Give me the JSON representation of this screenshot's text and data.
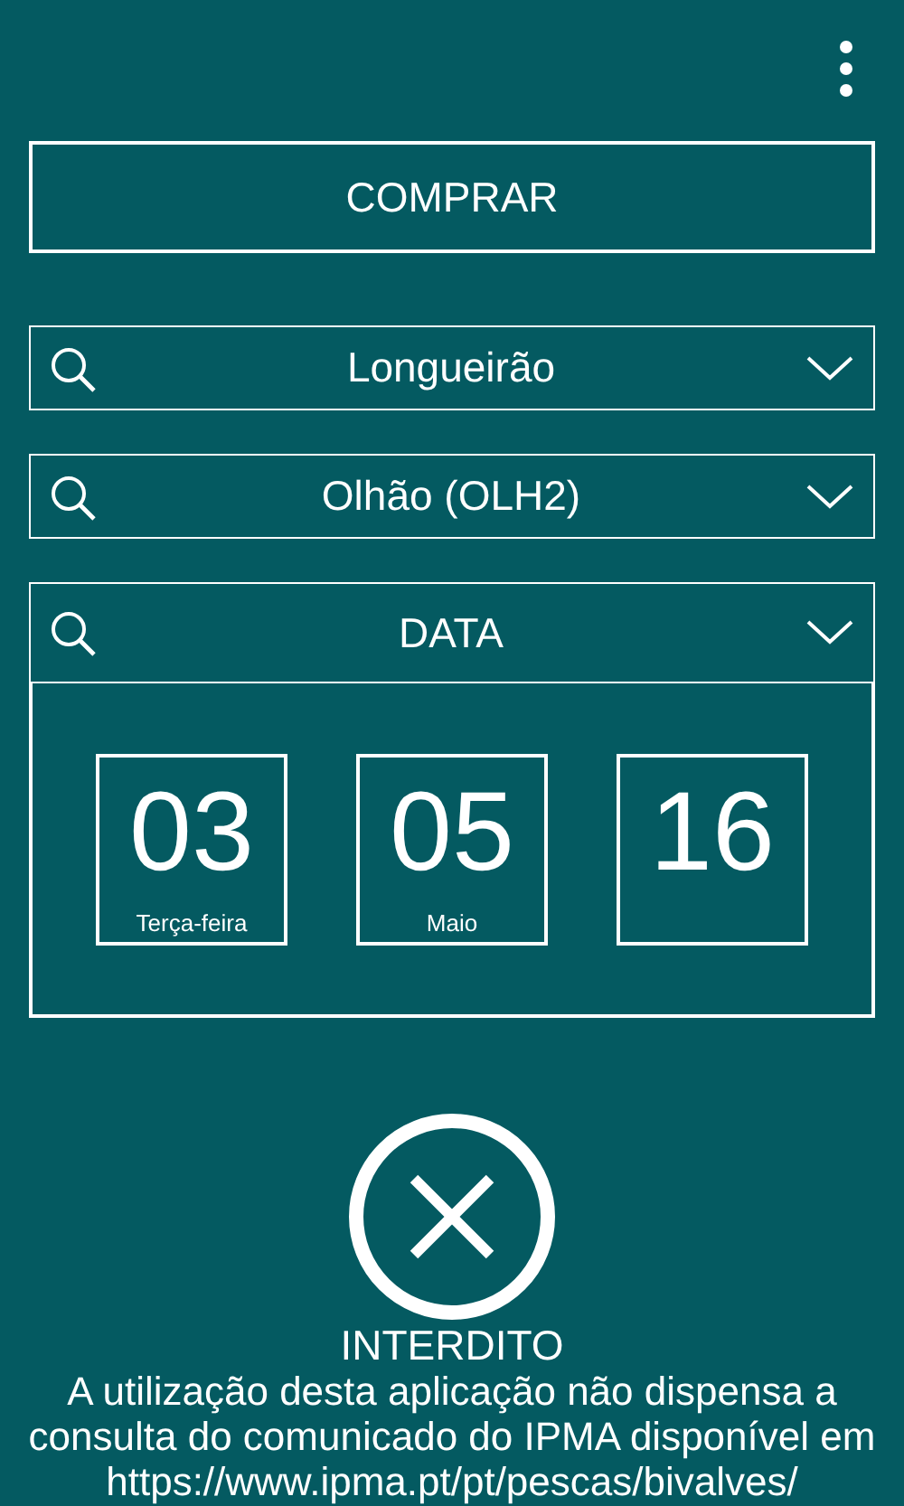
{
  "buy_button": {
    "label": "COMPRAR"
  },
  "selectors": [
    {
      "kind": "search",
      "value": "Longueirão"
    },
    {
      "kind": "search",
      "value": "Olhão (OLH2)"
    }
  ],
  "date": {
    "label": "DATA",
    "fields": [
      {
        "value": "03",
        "caption": "Terça-feira"
      },
      {
        "value": "05",
        "caption": "Maio"
      },
      {
        "value": "16"
      }
    ]
  },
  "status": {
    "kind": "prohibited",
    "label": "INTERDITO"
  },
  "notice": "A utilização desta aplicação não dispensa a consulta do comunicado do IPMA disponível em https://www.ipma.pt/pt/pescas/bivalves/"
}
